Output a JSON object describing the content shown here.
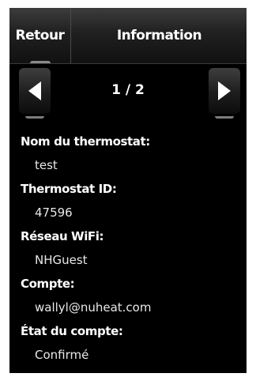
{
  "header": {
    "back_label": "Retour",
    "title": "Information"
  },
  "pager": {
    "indicator": "1 / 2",
    "prev_icon": "arrow-left-icon",
    "next_icon": "arrow-right-icon"
  },
  "fields": [
    {
      "label": "Nom du thermostat:",
      "value": "test"
    },
    {
      "label": "Thermostat ID:",
      "value": "47596"
    },
    {
      "label": "Réseau WiFi:",
      "value": "NHGuest"
    },
    {
      "label": "Compte:",
      "value": "wallyl@nuheat.com"
    },
    {
      "label": "État du compte:",
      "value": "Confirmé"
    }
  ],
  "colors": {
    "background": "#000000",
    "text": "#ffffff",
    "button": "#2a2a2a"
  }
}
